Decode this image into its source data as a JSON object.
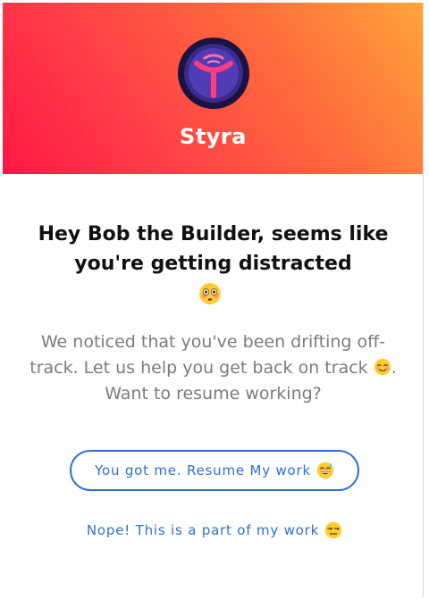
{
  "brand": {
    "name": "Styra",
    "logo_icon": "styra-logo-icon",
    "gradient_colors": [
      "#ff1744",
      "#ffa43a"
    ]
  },
  "headline": {
    "text": "Hey Bob the Builder, seems like you're getting distracted",
    "emoji_icon": "flushed-face-emoji-icon"
  },
  "message": {
    "part1": "We noticed that you've been drifting off-track. Let us help you get back on track",
    "emoji_icon": "smiling-face-emoji-icon",
    "part2": ". Want to resume working?"
  },
  "actions": {
    "resume_label": "You got me. Resume My work",
    "resume_emoji_icon": "grinning-sweat-emoji-icon",
    "nope_label": "Nope! This is a part of my work",
    "nope_emoji_icon": "unamused-face-emoji-icon",
    "accent_color": "#2e6fd3"
  }
}
